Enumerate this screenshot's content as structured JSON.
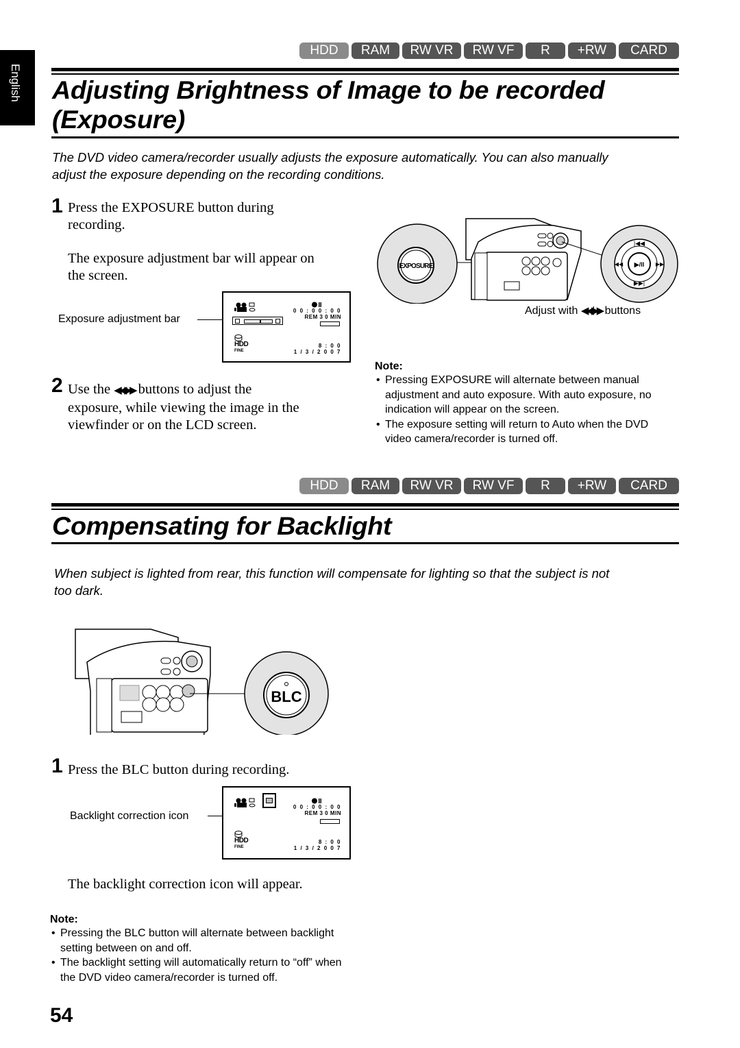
{
  "language_tab": "English",
  "media_badges": [
    "HDD",
    "RAM",
    "RW VR",
    "RW VF",
    "R",
    "+RW",
    "CARD"
  ],
  "active_badge": "HDD",
  "section1": {
    "title_line1": "Adjusting Brightness of Image to be recorded",
    "title_line2": "(Exposure)",
    "intro_line1": "The DVD video camera/recorder usually adjusts the exposure automatically. You can also manually",
    "intro_line2": "adjust the exposure depending on the recording conditions.",
    "step1": {
      "number": "1",
      "line1": "Press the EXPOSURE button during",
      "line2": "recording.",
      "sub_line1": "The exposure adjustment bar will appear on",
      "sub_line2": "the screen."
    },
    "screen_callout": "Exposure adjustment bar",
    "step2": {
      "number": "2",
      "line1_prefix": "Use the",
      "line1_buttons": "◀◀/▶▶",
      "line1_suffix": "buttons to adjust the",
      "line2": "exposure, while viewing the image in the",
      "line3": "viewfinder or on the LCD screen."
    },
    "figure_exposure_button": "EXPOSURE",
    "figure_caption_prefix": "Adjust with",
    "figure_caption_buttons": "◀◀/▶▶",
    "figure_caption_suffix": "buttons",
    "note": {
      "title": "Note:",
      "items": [
        "Pressing EXPOSURE will alternate between manual adjustment and auto exposure. With auto exposure, no indication will appear on the screen.",
        "The exposure setting will return to Auto when the DVD video camera/recorder is turned off."
      ]
    }
  },
  "lcd": {
    "counter": "0 0 : 0 0 : 0 0",
    "remaining": "REM 3 0 MIN",
    "media": "HDD",
    "quality": "FINE",
    "time": "8 : 0 0",
    "date": "1 /  3 / 2 0 0 7",
    "exposure_level": 0.55
  },
  "section2": {
    "title": "Compensating for Backlight",
    "intro_line1": "When subject is lighted from rear, this function will compensate for lighting so that the subject is not",
    "intro_line2": "too dark.",
    "figure_blc_button": "BLC",
    "step1": {
      "number": "1",
      "text": "Press the BLC button during recording."
    },
    "screen_callout": "Backlight correction icon",
    "after_text": "The backlight correction icon will appear.",
    "note": {
      "title": "Note:",
      "items": [
        "Pressing the BLC button will alternate between backlight setting between on and off.",
        "The backlight setting will automatically return to “off” when the DVD video camera/recorder is turned off."
      ]
    }
  },
  "page_number": "54"
}
